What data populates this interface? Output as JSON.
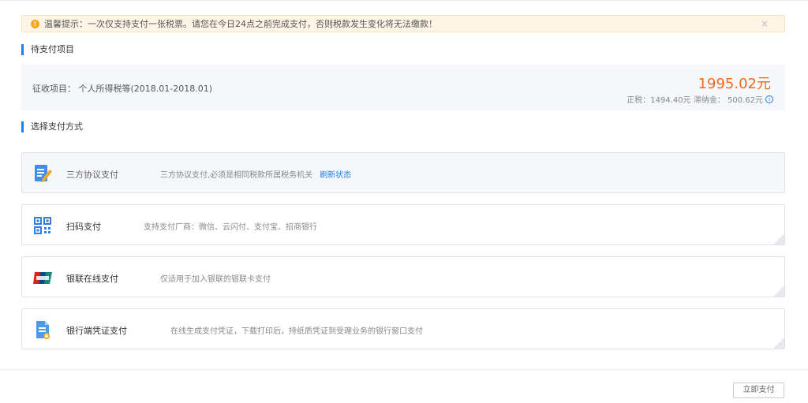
{
  "notice": {
    "text": "温馨提示：一次仅支持支付一张税票。请您在今日24点之前完成支付，否则税款发生变化将无法缴款！",
    "close": "×"
  },
  "pending": {
    "title": "待支付项目",
    "levy_label": "征收项目：  个人所得税等(2018.01-2018.01)",
    "amount": "1995.02元",
    "breakdown": "正税：1494.40元  滞纳金：  500.62元",
    "info": "i"
  },
  "payment": {
    "title": "选择支付方式",
    "methods": [
      {
        "name": "三方协议支付",
        "desc": "三方协议支付,必须是相同税款所属税务机关",
        "link": "刷新状态",
        "icon": "edit-document-icon"
      },
      {
        "name": "扫码支付",
        "desc": "支持支付厂商：微信、云闪付、支付宝、招商银行",
        "icon": "qr-code-icon"
      },
      {
        "name": "银联在线支付",
        "desc": "仅适用于加入银联的银联卡支付",
        "icon": "unionpay-icon"
      },
      {
        "name": "银行端凭证支付",
        "desc": "在线生成支付凭证，下载打印后，持纸质凭证到受理业务的银行窗口支付",
        "icon": "bank-voucher-icon"
      }
    ]
  },
  "footer": {
    "pay_button": "立即支付"
  },
  "colors": {
    "accent": "#1e7fe6",
    "amount": "#f06a1a",
    "warning": "#f5a623"
  }
}
